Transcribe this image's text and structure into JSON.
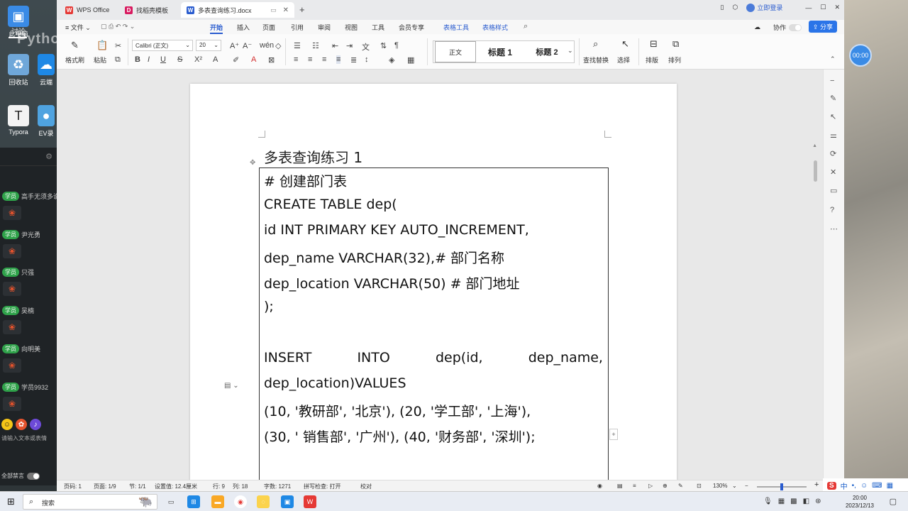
{
  "desktop": {
    "overlay_text": "Python入门到精通",
    "icons": [
      {
        "label": "此电脑",
        "icon": "computer-icon"
      },
      {
        "label": "回收站",
        "icon": "recycle-bin-icon"
      },
      {
        "label": "云端",
        "icon": "cloud-icon"
      },
      {
        "label": "Typora",
        "icon": "typora-icon"
      },
      {
        "label": "EV录",
        "icon": "ev-recorder-icon"
      }
    ]
  },
  "chat": {
    "tab_label": "讨论",
    "students": [
      {
        "badge": "学员",
        "name": "高手无须多说"
      },
      {
        "badge": "学员",
        "name": "尹光勇"
      },
      {
        "badge": "学员",
        "name": "只强"
      },
      {
        "badge": "学员",
        "name": "吴楠"
      },
      {
        "badge": "学员",
        "name": "向明美"
      },
      {
        "badge": "学员",
        "name": "学员9932"
      }
    ],
    "input_placeholder": "请输入文本或表情",
    "mute_label": "全部禁言"
  },
  "window": {
    "tabs": [
      {
        "label": "WPS Office",
        "icon_color": "#e53935",
        "icon": "W"
      },
      {
        "label": "找稻壳模板",
        "icon_color": "#d81b60",
        "icon": "D"
      },
      {
        "label": "多表查询练习.docx",
        "icon_color": "#2a5ccf",
        "icon": "W",
        "active": true
      }
    ],
    "add_tab": "+",
    "login_label": "立即登录",
    "menu": [
      "文件",
      "开始",
      "插入",
      "页面",
      "引用",
      "审阅",
      "视图",
      "工具",
      "会员专享",
      "表格工具",
      "表格样式"
    ],
    "active_menu": "开始",
    "collab_label": "协作",
    "share_label": "分享"
  },
  "ribbon": {
    "format_painter": "格式刷",
    "paste": "粘贴",
    "font_name": "Calibri (正文)",
    "font_size": "20",
    "styles": [
      "正文",
      "标题 1",
      "标题 2"
    ],
    "find_replace": "查找替换",
    "select": "选择",
    "layout": "排版",
    "arrange": "排列"
  },
  "document": {
    "title": "多表查询练习 1",
    "lines": [
      "#  创建部门表",
      "CREATE TABLE dep(",
      "id INT PRIMARY KEY AUTO_INCREMENT,",
      "dep_name VARCHAR(32),#  部门名称",
      "dep_location VARCHAR(50) #  部门地址",
      ");",
      "",
      "",
      "dep_location)VALUES",
      "(10, '教研部', '北京'), (20, '学工部', '上海'),",
      "(30, '  销售部', '广州'), (40, '财务部', '深圳');"
    ],
    "insert_words": [
      "INSERT",
      "INTO",
      "dep(id,",
      "dep_name,"
    ]
  },
  "status": {
    "page": "页码: 1",
    "pages": "页面: 1/9",
    "section": "节: 1/1",
    "setting": "设置值: 12.4厘米",
    "row": "行: 9",
    "col": "列: 18",
    "words": "字数: 1271",
    "spell": "拼写检查: 打开",
    "proof": "校对",
    "zoom": "130%"
  },
  "timer": "00:00",
  "taskbar": {
    "search_placeholder": "搜索",
    "time": "20:00",
    "date": "2023/12/13"
  },
  "ime": {
    "lang": "中"
  }
}
